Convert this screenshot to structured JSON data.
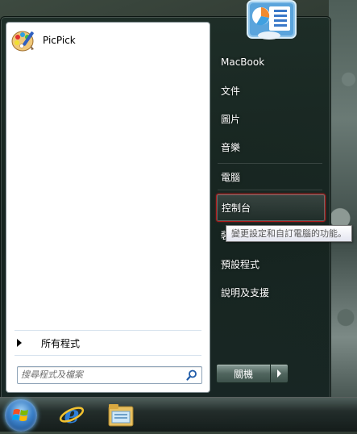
{
  "left_panel": {
    "pinned": [
      {
        "label": "PicPick",
        "icon": "picpick-palette-icon"
      }
    ],
    "all_programs_label": "所有程式",
    "search_placeholder": "搜尋程式及檔案"
  },
  "right_panel": {
    "items": [
      {
        "label": "MacBook"
      },
      {
        "label": "文件"
      },
      {
        "label": "圖片"
      },
      {
        "label": "音樂"
      },
      {
        "label": "電腦"
      },
      {
        "label": "控制台",
        "selected": true
      },
      {
        "label": "裝置和印表機"
      },
      {
        "label": "預設程式"
      },
      {
        "label": "說明及支援"
      }
    ],
    "tooltip": "變更設定和自訂電腦的功能。",
    "shutdown_label": "關機"
  },
  "taskbar": {
    "items": [
      {
        "icon": "windows-start-orb-icon"
      },
      {
        "icon": "internet-explorer-icon"
      },
      {
        "icon": "windows-explorer-folder-icon"
      }
    ]
  },
  "colors": {
    "selection_border": "#b01c1c",
    "menu_background": "#1c2c26"
  }
}
